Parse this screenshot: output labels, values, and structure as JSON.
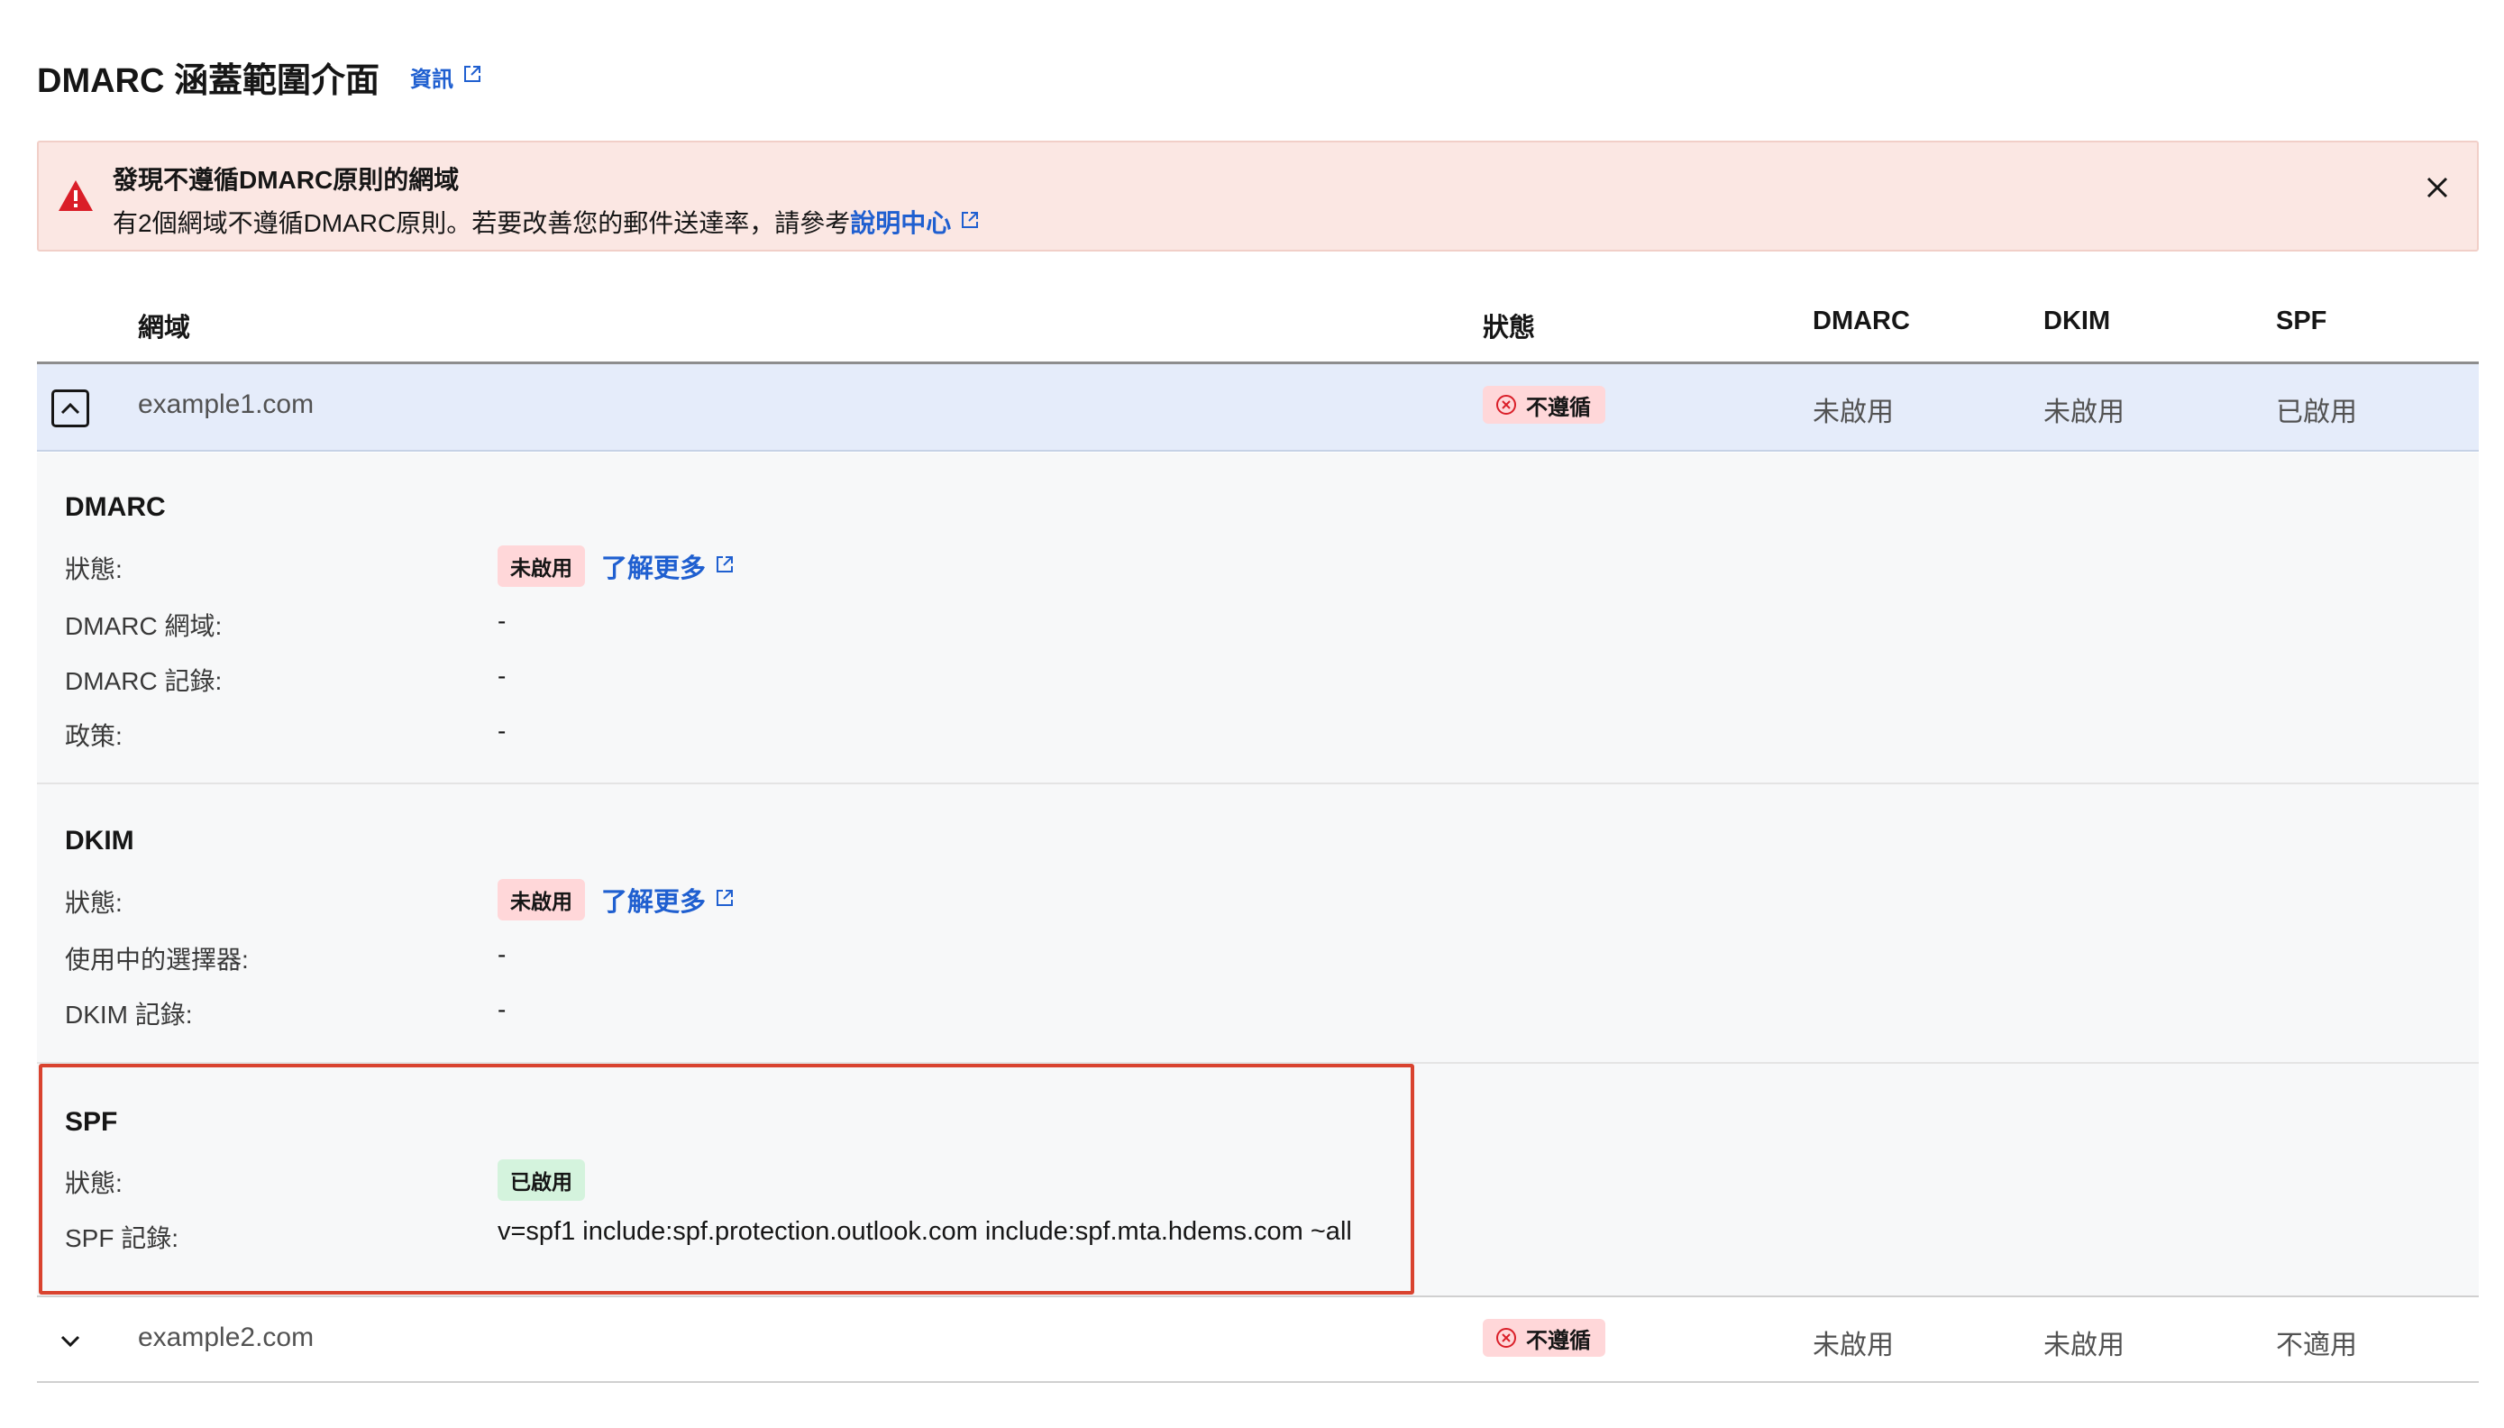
{
  "page": {
    "title": "DMARC 涵蓋範圍介面",
    "info_link": "資訊"
  },
  "banner": {
    "title": "發現不遵循DMARC原則的網域",
    "message": "有2個網域不遵循DMARC原則。若要改善您的郵件送達率，請參考",
    "link": "說明中心"
  },
  "table": {
    "headers": {
      "domain": "網域",
      "status": "狀態",
      "dmarc": "DMARC",
      "dkim": "DKIM",
      "spf": "SPF"
    },
    "rows": [
      {
        "domain": "example1.com",
        "status": "不遵循",
        "dmarc": "未啟用",
        "dkim": "未啟用",
        "spf": "已啟用"
      },
      {
        "domain": "example2.com",
        "status": "不遵循",
        "dmarc": "未啟用",
        "dkim": "未啟用",
        "spf": "不適用"
      }
    ]
  },
  "details": {
    "dmarc": {
      "title": "DMARC",
      "status_label": "狀態:",
      "status_value": "未啟用",
      "learn_more": "了解更多",
      "domain_label": "DMARC 網域:",
      "domain_value": "-",
      "record_label": "DMARC 記錄:",
      "record_value": "-",
      "policy_label": "政策:",
      "policy_value": "-"
    },
    "dkim": {
      "title": "DKIM",
      "status_label": "狀態:",
      "status_value": "未啟用",
      "learn_more": "了解更多",
      "selector_label": "使用中的選擇器:",
      "selector_value": "-",
      "record_label": "DKIM 記錄:",
      "record_value": "-"
    },
    "spf": {
      "title": "SPF",
      "status_label": "狀態:",
      "status_value": "已啟用",
      "record_label": "SPF 記錄:",
      "record_value": "v=spf1 include:spf.protection.outlook.com include:spf.mta.hdems.com ~all"
    }
  },
  "colors": {
    "link": "#1f5fd0",
    "error": "#da1e28",
    "error_bg": "#ffd7d9",
    "success_bg": "#d4f3dd",
    "highlight": "#d9432f",
    "selected_row": "#e5ecfa",
    "banner_bg": "#fbe7e3"
  }
}
